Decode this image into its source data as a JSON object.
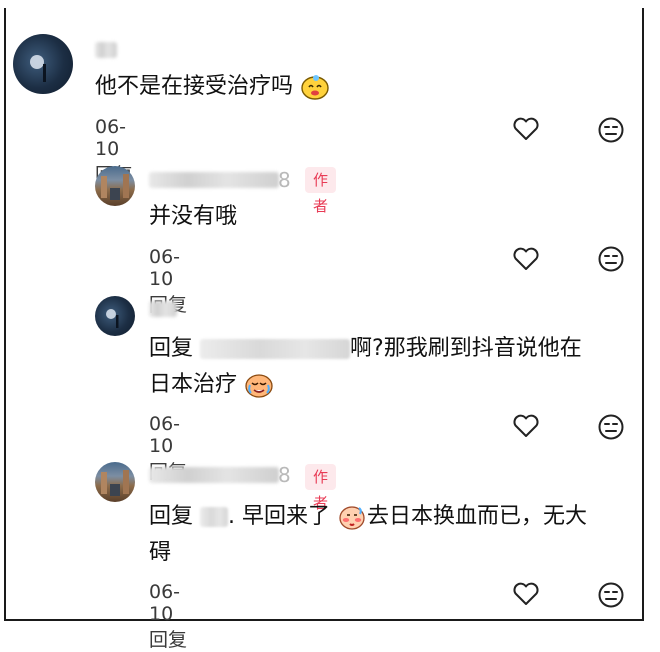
{
  "comments": [
    {
      "name_tail": "",
      "text": "他不是在接受治疗吗",
      "date": "06-10",
      "reply_label": "回复"
    },
    {
      "name_tail": "8",
      "author_badge": "作者",
      "text": "并没有哦",
      "date": "06-10",
      "reply_label": "回复"
    },
    {
      "name_tail": "",
      "reply_prefix": "回复",
      "text_a": "啊?那我刷到抖音说他在",
      "text_b": "日本治疗",
      "date": "06-10",
      "reply_label": "回复"
    },
    {
      "name_tail": "8",
      "author_badge": "作者",
      "reply_prefix": "回复",
      "text_a": ". 早回来了",
      "text_b": "去日本换血而已，无大",
      "text_c": "碍",
      "date": "06-10",
      "reply_label": "回复"
    }
  ],
  "icons": {
    "like": "heart-outline-icon",
    "dislike": "meh-face-icon",
    "emoji_smile": "smiling-face-emoji",
    "emoji_cry": "crying-face-emoji",
    "emoji_blush": "blushing-face-emoji"
  },
  "colors": {
    "badge_bg": "#fde9ec",
    "badge_text": "#e83b55"
  }
}
